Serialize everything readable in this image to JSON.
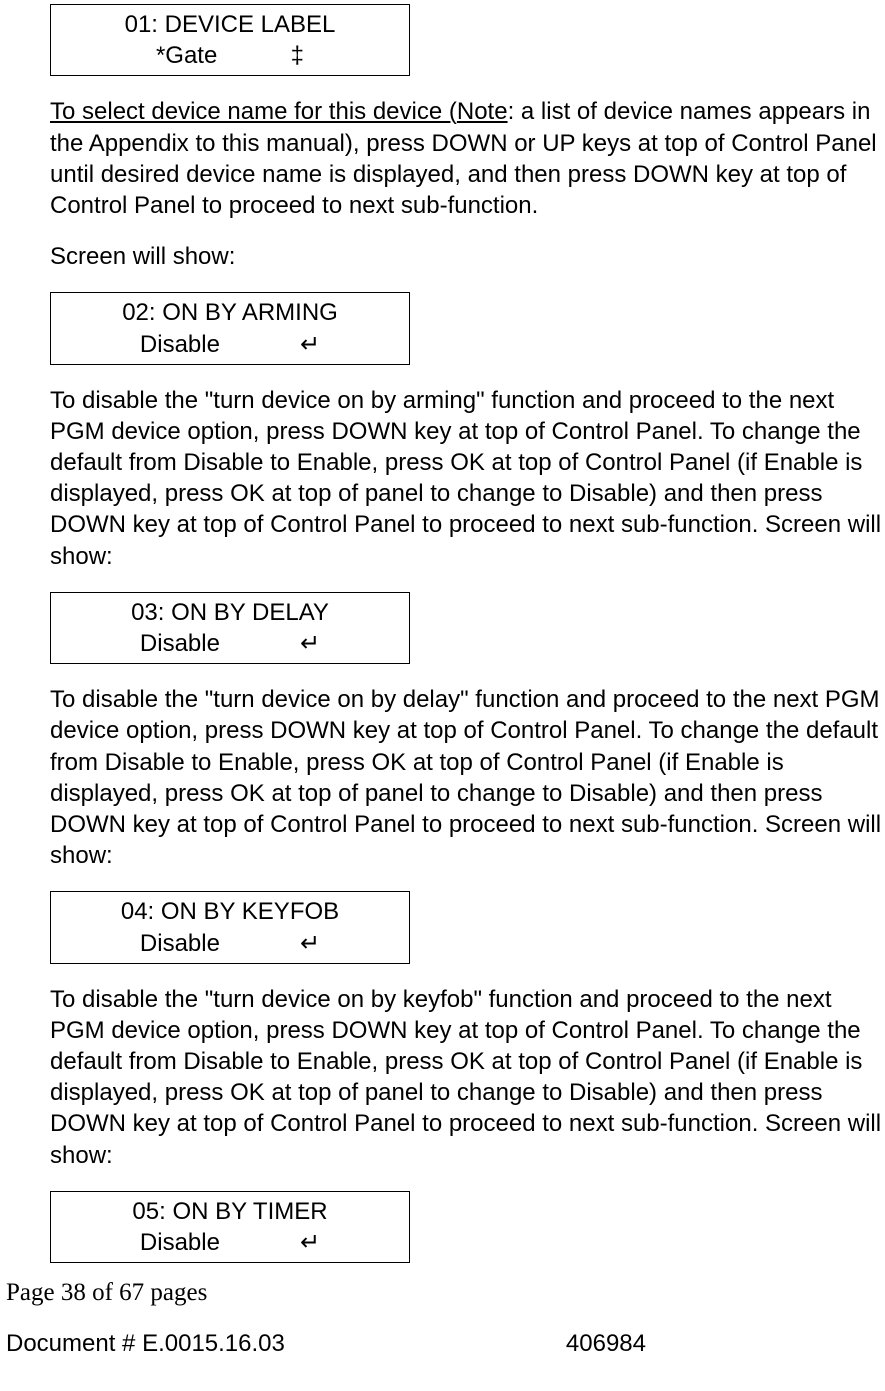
{
  "lcd1": {
    "line1": "01: DEVICE LABEL",
    "line2": "*Gate           ‡"
  },
  "para1_underline": "To select device name for this device (",
  "para1_note_u": "Note",
  "para1_rest": ": a list of device names appears in the Appendix to this manual), press DOWN or UP keys at top of Control Panel until desired device name is displayed, and then press DOWN key at top of Control Panel to proceed to next sub-function.",
  "screen_will_show": "Screen will show:",
  "lcd2": {
    "line1": "02: ON BY ARMING",
    "line2": "Disable            ↵"
  },
  "para2": "To disable the \"turn device on by arming\" function and proceed to the next PGM device option, press DOWN key at top of Control Panel. To change the default from Disable to Enable, press OK at top of Control Panel (if Enable is displayed, press OK at top of panel to change to Disable) and then press DOWN key at top of Control Panel to proceed to next sub-function. Screen will show:",
  "lcd3": {
    "line1": "03: ON BY DELAY",
    "line2": "Disable            ↵"
  },
  "para3": "To disable the \"turn device on by delay\" function and proceed to the next PGM device option, press DOWN key at top of Control Panel. To change the default from Disable to Enable, press OK at top of Control Panel (if Enable is displayed, press OK at top of panel to change to Disable) and then press DOWN key at top of Control Panel to proceed to next sub-function. Screen will show:",
  "lcd4": {
    "line1": "04: ON BY KEYFOB",
    "line2": "Disable            ↵"
  },
  "para4": "To disable the \"turn device on by keyfob\" function and proceed to the next PGM device option, press DOWN key at top of Control Panel. To change the default from Disable to Enable, press OK at top of Control Panel (if Enable is displayed, press OK at top of panel to change to Disable) and then press DOWN key at top of Control Panel to proceed to next sub-function. Screen will show:",
  "lcd5": {
    "line1": "05: ON BY TIMER",
    "line2": "Disable            ↵"
  },
  "footer": {
    "page": "Page 38 of  67 pages",
    "docnum": "Document # E.0015.16.03",
    "code": "406984"
  }
}
